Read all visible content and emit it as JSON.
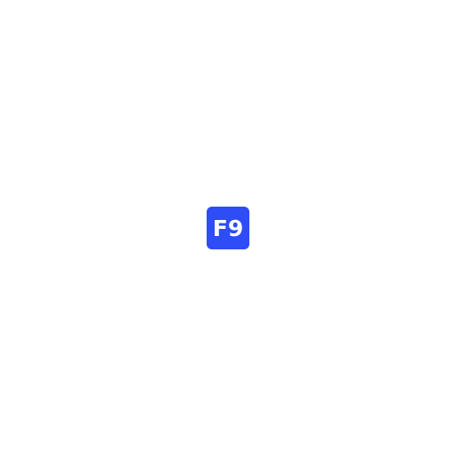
{
  "app_icon": {
    "label": "F9",
    "background_color": "#2e4df7",
    "text_color": "#ffffff"
  }
}
